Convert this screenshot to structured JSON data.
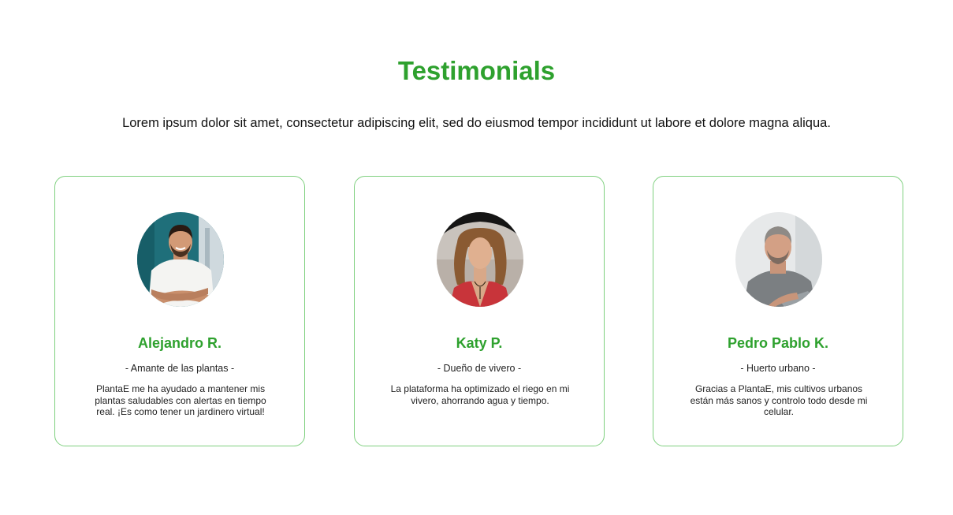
{
  "section": {
    "title": "Testimonials",
    "subtitle": "Lorem ipsum dolor sit amet, consectetur adipiscing elit, sed do eiusmod tempor incididunt ut labore et dolore magna aliqua."
  },
  "testimonials": [
    {
      "name": "Alejandro R.",
      "role": "- Amante de las plantas -",
      "quote": "PlantaE me ha ayudado a mantener mis plantas saludables con alertas en tiempo real. ¡Es como tener un jardinero virtual!"
    },
    {
      "name": "Katy P.",
      "role": "- Dueño de vivero -",
      "quote": "La plataforma ha optimizado el riego en mi vivero, ahorrando agua y tiempo."
    },
    {
      "name": "Pedro Pablo K.",
      "role": "- Huerto urbano -",
      "quote": "Gracias a PlantaE, mis cultivos urbanos están más sanos y controlo todo desde mi celular."
    }
  ],
  "colors": {
    "accent": "#2ea12e",
    "card_border": "#7fd07f",
    "text": "#111111"
  }
}
